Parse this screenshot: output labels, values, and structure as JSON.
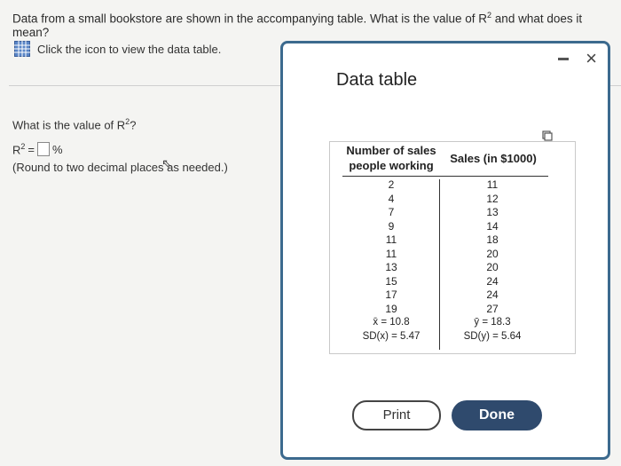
{
  "question": {
    "text_pre": "Data from a small bookstore are shown in the accompanying table. What is the value of R",
    "sup": "2",
    "text_post": " and what does it mean?"
  },
  "data_link": {
    "label": "Click the icon to view the data table."
  },
  "subquestion": {
    "pre": "What is the value of R",
    "sup": "2",
    "post": "?"
  },
  "answer": {
    "pre": "R",
    "sup": "2",
    "eq": " = ",
    "unit": "%"
  },
  "hint": "(Round to two decimal places as needed.)",
  "modal": {
    "title": "Data table",
    "close_label": "×",
    "table": {
      "headers": [
        "Number of sales people working",
        "Sales (in $1000)"
      ],
      "people": [
        "2",
        "4",
        "7",
        "9",
        "11",
        "11",
        "13",
        "15",
        "17",
        "19"
      ],
      "sales": [
        "11",
        "12",
        "13",
        "14",
        "18",
        "20",
        "20",
        "24",
        "24",
        "27"
      ],
      "mean_x": "x̄ = 10.8",
      "sd_x": "SD(x) = 5.47",
      "mean_y": "ȳ = 18.3",
      "sd_y": "SD(y) = 5.64"
    },
    "print_label": "Print",
    "done_label": "Done"
  },
  "colors": {
    "modal_border": "#3c6a8e",
    "done_bg": "#2f4a6d"
  },
  "icons": {
    "data_table": "grid-table-icon",
    "copy": "copy-icon",
    "minimize": "minimize-icon",
    "close": "close-icon"
  }
}
